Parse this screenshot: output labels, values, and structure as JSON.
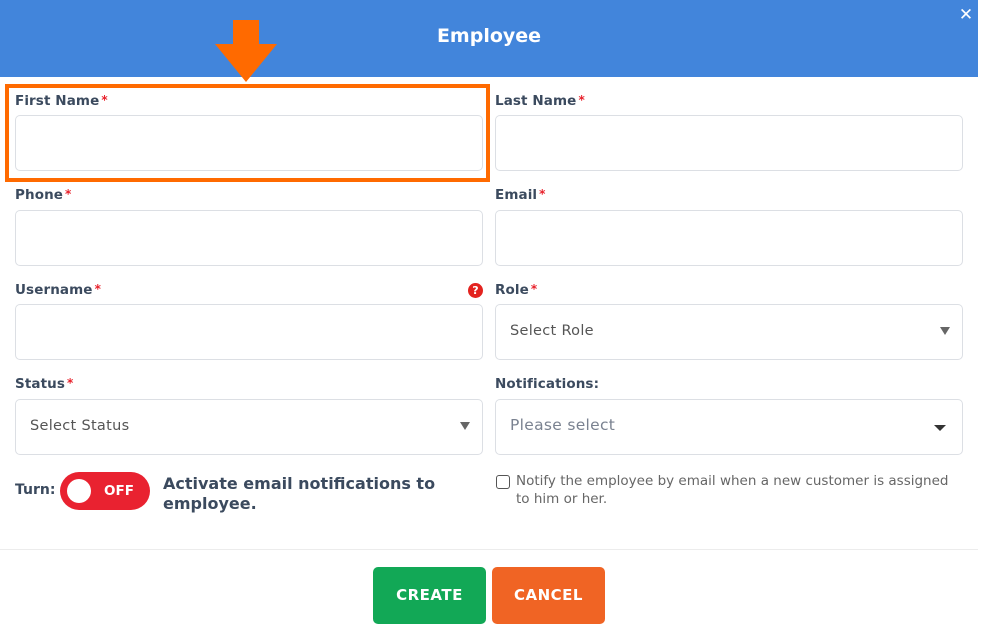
{
  "header": {
    "title": "Employee",
    "close_label": "✕"
  },
  "colors": {
    "header_bg": "#4285db",
    "required_star": "#e8212b",
    "toggle_off": "#e92230",
    "create_button": "#12a856",
    "cancel_button": "#f06424",
    "annotation": "#ff6a00"
  },
  "form": {
    "first_name": {
      "label": "First Name",
      "required": "*",
      "value": ""
    },
    "last_name": {
      "label": "Last Name",
      "required": "*",
      "value": ""
    },
    "phone": {
      "label": "Phone",
      "required": "*",
      "value": ""
    },
    "email": {
      "label": "Email",
      "required": "*",
      "value": ""
    },
    "username": {
      "label": "Username",
      "required": "*",
      "value": "",
      "help_icon": "?"
    },
    "role": {
      "label": "Role",
      "required": "*",
      "selected": "Select Role"
    },
    "status": {
      "label": "Status",
      "required": "*",
      "selected": "Select Status"
    },
    "notifications": {
      "label": "Notifications:",
      "selected": "Please select"
    },
    "turn": {
      "label": "Turn:",
      "toggle_state": "OFF",
      "description": "Activate email notifications to employee."
    },
    "notify_checkbox": {
      "checked": false,
      "label": "Notify the employee by email when a new customer is assigned to him or her."
    }
  },
  "footer": {
    "create_label": "CREATE",
    "cancel_label": "CANCEL"
  }
}
